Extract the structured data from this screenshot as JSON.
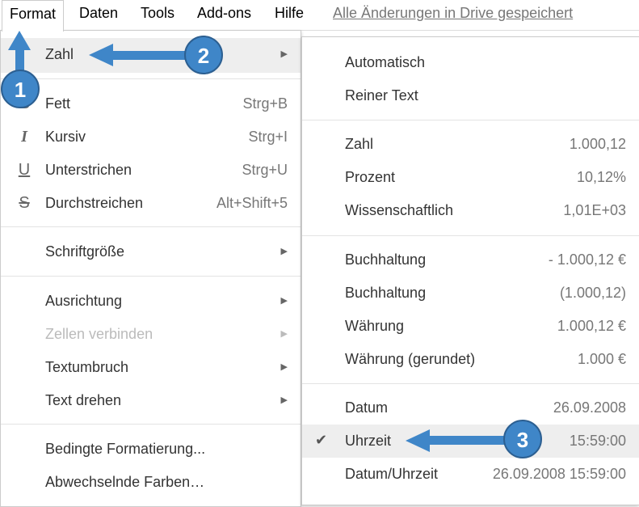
{
  "menubar": {
    "items": [
      "Format",
      "Daten",
      "Tools",
      "Add-ons",
      "Hilfe"
    ],
    "saved_status": "Alle Änderungen in Drive gespeichert"
  },
  "format_menu": {
    "zahl": "Zahl",
    "fett": {
      "label": "Fett",
      "shortcut": "Strg+B",
      "icon": "bold-icon"
    },
    "kursiv": {
      "label": "Kursiv",
      "shortcut": "Strg+I",
      "icon": "italic-icon"
    },
    "unterstrichen": {
      "label": "Unterstrichen",
      "shortcut": "Strg+U",
      "icon": "underline-icon"
    },
    "durchstreichen": {
      "label": "Durchstreichen",
      "shortcut": "Alt+Shift+5",
      "icon": "strikethrough-icon"
    },
    "schriftgroesse": "Schriftgröße",
    "ausrichtung": "Ausrichtung",
    "zellen_verbinden": "Zellen verbinden",
    "textumbruch": "Textumbruch",
    "text_drehen": "Text drehen",
    "bedingte": "Bedingte Formatierung...",
    "abwechselnde": "Abwechselnde Farben…"
  },
  "number_submenu": {
    "items": [
      {
        "label": "Automatisch",
        "example": ""
      },
      {
        "label": "Reiner Text",
        "example": ""
      },
      {
        "label": "Zahl",
        "example": "1.000,12"
      },
      {
        "label": "Prozent",
        "example": "10,12%"
      },
      {
        "label": "Wissenschaftlich",
        "example": "1,01E+03"
      },
      {
        "label": "Buchhaltung",
        "example": "- 1.000,12 €"
      },
      {
        "label": "Buchhaltung",
        "example": "(1.000,12)"
      },
      {
        "label": "Währung",
        "example": "1.000,12 €"
      },
      {
        "label": "Währung (gerundet)",
        "example": "1.000 €"
      },
      {
        "label": "Datum",
        "example": "26.09.2008"
      },
      {
        "label": "Uhrzeit",
        "example": "15:59:00",
        "selected": true
      },
      {
        "label": "Datum/Uhrzeit",
        "example": "26.09.2008 15:59:00"
      }
    ]
  },
  "annotations": [
    "1",
    "2",
    "3"
  ],
  "colors": {
    "annotation": "#3f86c8"
  }
}
